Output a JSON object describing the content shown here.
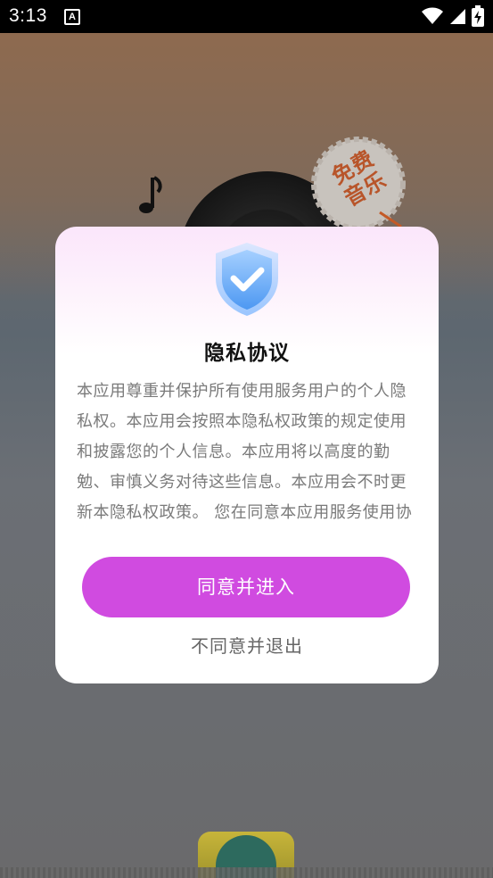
{
  "status_bar": {
    "time": "3:13",
    "notification_letter": "A",
    "icons": [
      "wifi-icon",
      "signal-icon",
      "battery-charging-icon"
    ]
  },
  "background": {
    "badge_text": "免费音乐",
    "accent_color": "#b8552a"
  },
  "dialog": {
    "title": "隐私协议",
    "body": "本应用尊重并保护所有使用服务用户的个人隐私权。本应用会按照本隐私权政策的规定使用和披露您的个人信息。本应用将以高度的勤勉、审慎义务对待这些信息。本应用会不时更新本隐私权政策。 您在同意本应用服务使用协",
    "agree_label": "同意并进入",
    "disagree_label": "不同意并退出",
    "agree_color": "#d04be0"
  }
}
